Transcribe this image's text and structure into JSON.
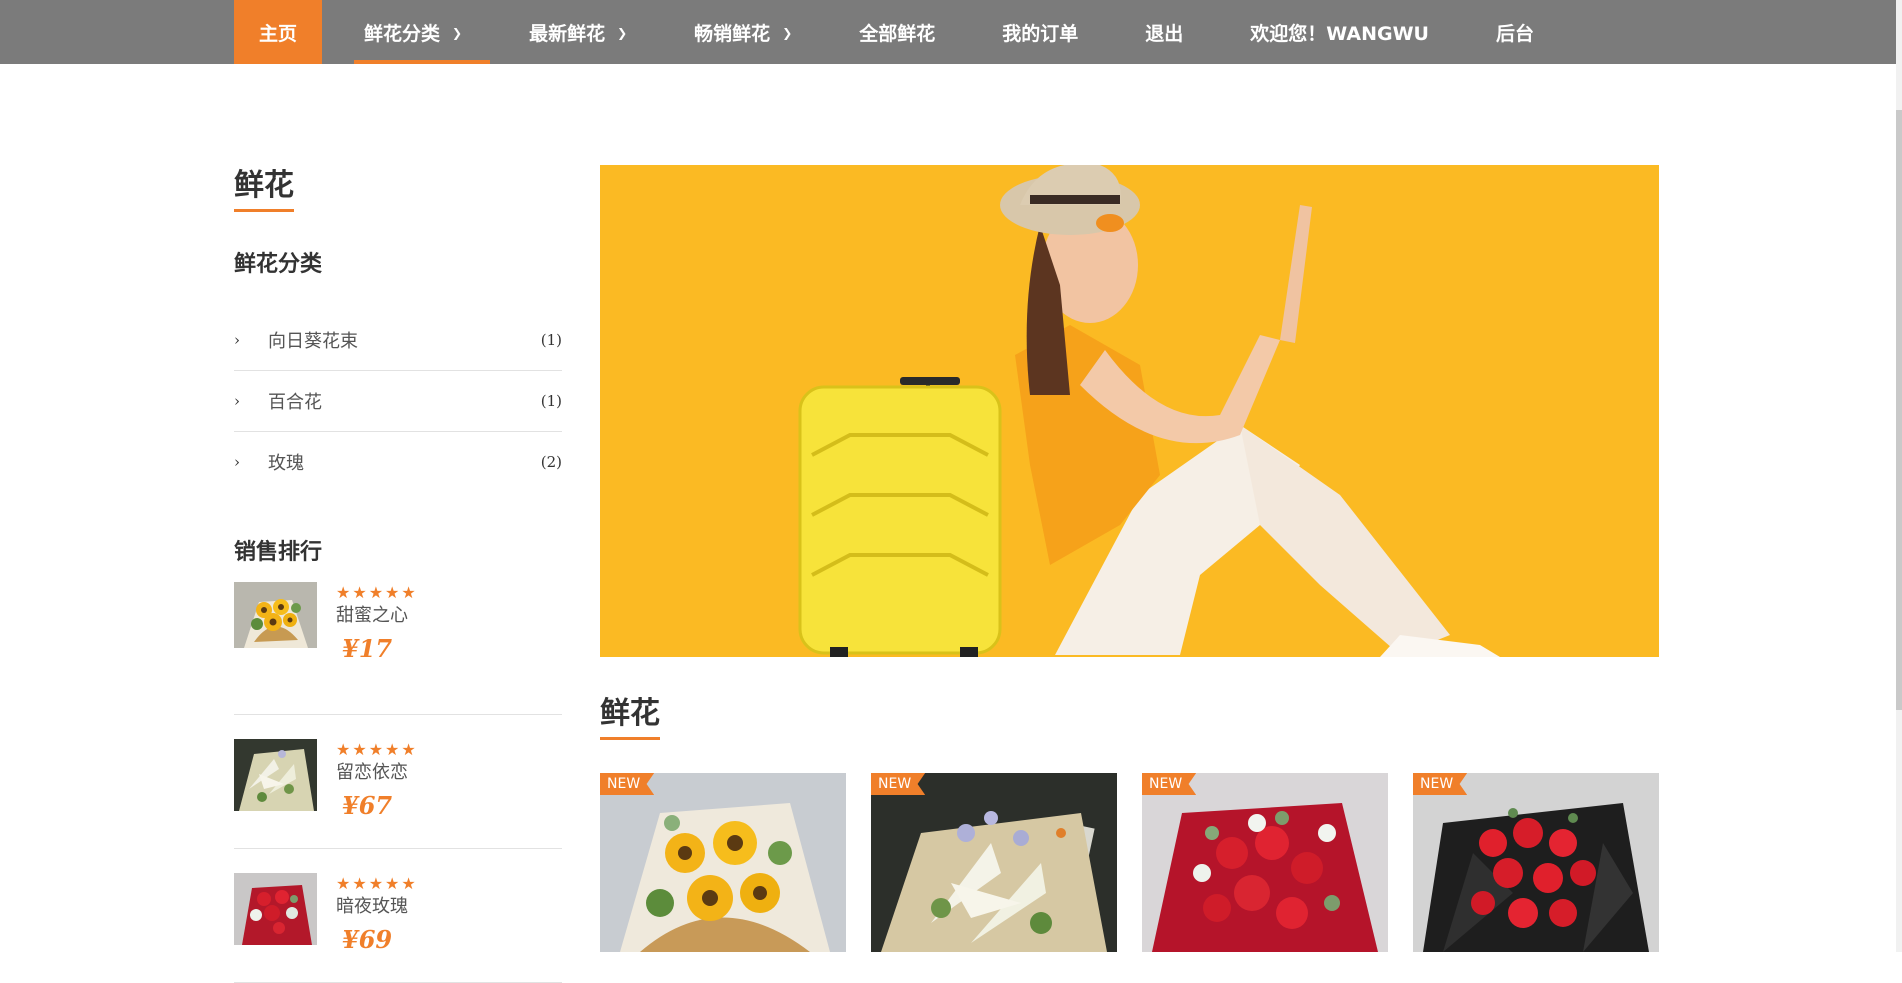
{
  "nav": {
    "items": [
      {
        "label": "主页",
        "dropdown": false,
        "active": true
      },
      {
        "label": "鲜花分类",
        "dropdown": true,
        "underline": true
      },
      {
        "label": "最新鲜花",
        "dropdown": true
      },
      {
        "label": "畅销鲜花",
        "dropdown": true
      },
      {
        "label": "全部鲜花",
        "dropdown": false
      },
      {
        "label": "我的订单",
        "dropdown": false
      },
      {
        "label": "退出",
        "dropdown": false
      },
      {
        "label": "欢迎您！WANGWU",
        "dropdown": false
      },
      {
        "label": "后台",
        "dropdown": false
      }
    ],
    "accent_color": "#f07f2a",
    "bar_color": "#7b7b7b"
  },
  "sidebar": {
    "title": "鲜花",
    "category_title": "鲜花分类",
    "categories": [
      {
        "name": "向日葵花束",
        "count": "(1)"
      },
      {
        "name": "百合花",
        "count": "(1)"
      },
      {
        "name": "玫瑰",
        "count": "(2)"
      }
    ],
    "ranking_title": "销售排行",
    "ranking": [
      {
        "name": "甜蜜之心",
        "price": "¥17",
        "stars": "★★★★★",
        "image": "sunflower-bouquet"
      },
      {
        "name": "留恋依恋",
        "price": "¥67",
        "stars": "★★★★★",
        "image": "lily-bouquet"
      },
      {
        "name": "暗夜玫瑰",
        "price": "¥69",
        "stars": "★★★★★",
        "image": "red-rose-bouquet"
      }
    ]
  },
  "banner": {
    "image": "woman-with-yellow-suitcase"
  },
  "main": {
    "section_title": "鲜花",
    "products": [
      {
        "badge": "NEW",
        "image": "sunflower-bouquet"
      },
      {
        "badge": "NEW",
        "image": "lily-bouquet"
      },
      {
        "badge": "NEW",
        "image": "red-rose-white-bouquet"
      },
      {
        "badge": "NEW",
        "image": "red-rose-black-wrap"
      }
    ]
  }
}
